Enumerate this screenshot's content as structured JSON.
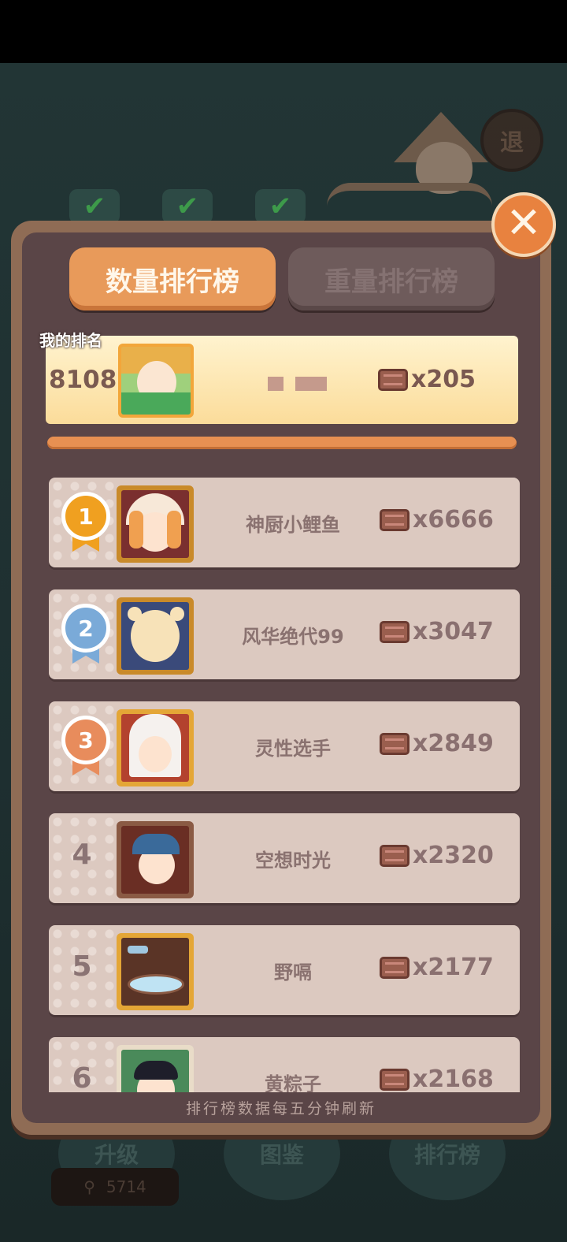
{
  "tabs": {
    "active": "数量排行榜",
    "inactive": "重量排行榜"
  },
  "my_rank": {
    "label": "我的排名",
    "rank": "8108",
    "score": "x205"
  },
  "leaderboard": [
    {
      "rank": "1",
      "name": "神厨小鲤鱼",
      "score": "x6666",
      "medal_color": "#f0a020"
    },
    {
      "rank": "2",
      "name": "风华绝代99",
      "score": "x3047",
      "medal_color": "#7aaad8"
    },
    {
      "rank": "3",
      "name": "灵性选手",
      "score": "x2849",
      "medal_color": "#e88c5c"
    },
    {
      "rank": "4",
      "name": "空想时光",
      "score": "x2320"
    },
    {
      "rank": "5",
      "name": "野嗝",
      "score": "x2177"
    },
    {
      "rank": "6",
      "name": "黄粽子",
      "score": "x2168"
    }
  ],
  "footer_note": "排行榜数据每五分钟刷新",
  "background": {
    "exit_label": "退",
    "buttons": [
      "升级",
      "图鉴",
      "排行榜"
    ],
    "coins": "5714"
  },
  "icons": {
    "close": "close-icon",
    "item": "box-item-icon",
    "medal": "medal-icon"
  }
}
